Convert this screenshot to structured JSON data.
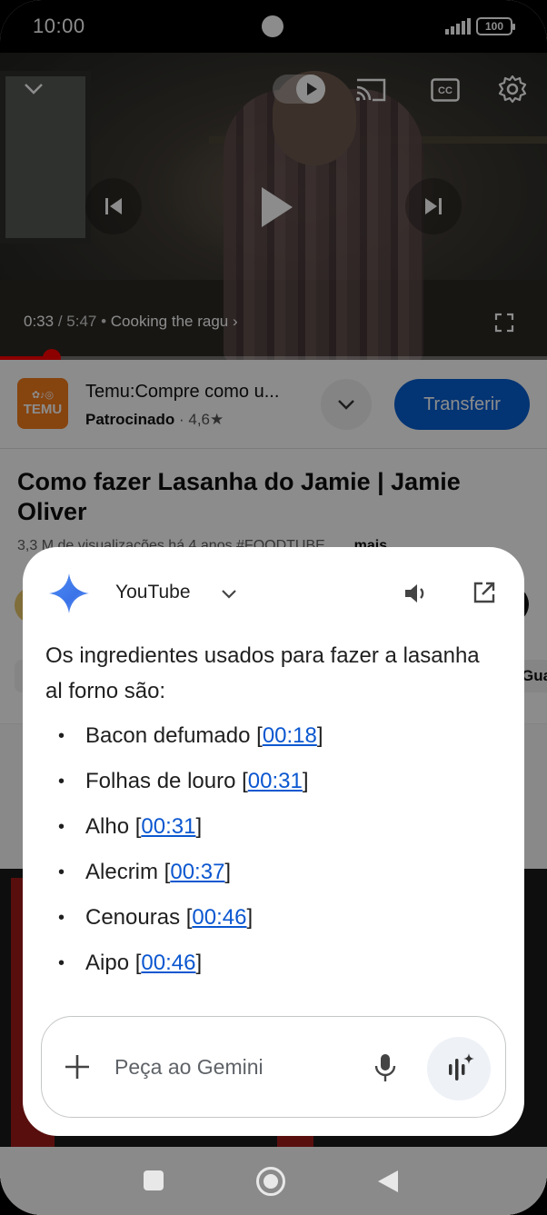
{
  "status_bar": {
    "time": "10:00",
    "battery": "100"
  },
  "video": {
    "current_time": "0:33",
    "duration": "5:47",
    "chapter": "Cooking the ragu",
    "progress": 0.095
  },
  "ad": {
    "logo_text": "TEMU",
    "title": "Temu:Compre como u...",
    "sponsored": "Patrocinado",
    "rating": "4,6★",
    "install_label": "Transferir"
  },
  "video_info": {
    "title": "Como fazer Lasanha do Jamie | Jamie Oliver",
    "meta": "3,3 M de visualizações  há 4 anos  #FOODTUBE",
    "more": "...mais",
    "chip_partial": "Gua"
  },
  "gemini": {
    "app_name": "YouTube",
    "intro": "Os ingredientes usados para fazer a lasanha al forno são:",
    "items": [
      {
        "name": "Bacon defumado",
        "timestamp": "00:18"
      },
      {
        "name": "Folhas de louro",
        "timestamp": "00:31"
      },
      {
        "name": "Alho",
        "timestamp": "00:31"
      },
      {
        "name": "Alecrim",
        "timestamp": "00:37"
      },
      {
        "name": "Cenouras",
        "timestamp": "00:46"
      },
      {
        "name": "Aipo",
        "timestamp": "00:46"
      }
    ],
    "input_placeholder": "Peça ao Gemini"
  },
  "colors": {
    "accent": "#0b57d0",
    "youtube_red": "#ff0000",
    "install_blue": "#065fd4",
    "temu_orange": "#f57c1c"
  },
  "icons": {
    "video": [
      "chevron-down-icon",
      "autoplay-toggle-icon",
      "cast-icon",
      "captions-icon",
      "settings-gear-icon",
      "previous-icon",
      "play-icon",
      "next-icon",
      "fullscreen-icon"
    ],
    "gemini": [
      "gemini-sparkle-icon",
      "chevron-down-icon",
      "speaker-icon",
      "open-external-icon",
      "plus-icon",
      "microphone-icon",
      "gemini-live-icon"
    ],
    "nav": [
      "recents-icon",
      "home-icon",
      "back-icon"
    ]
  }
}
